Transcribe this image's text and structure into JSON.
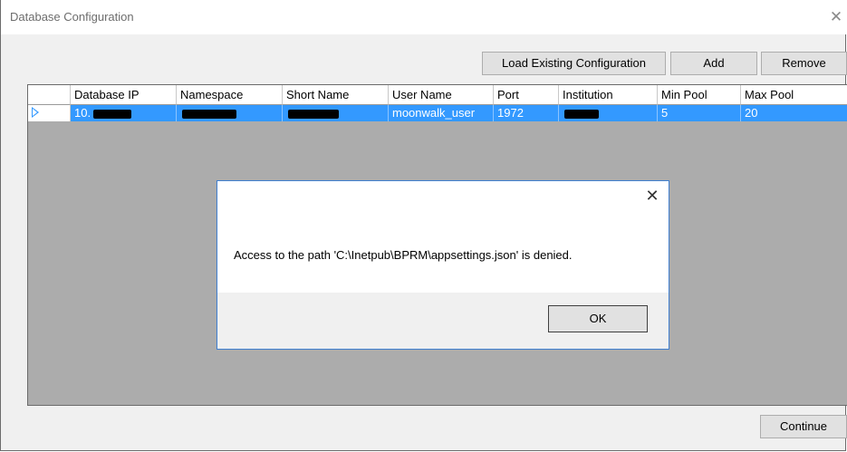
{
  "window": {
    "title": "Database Configuration",
    "close_glyph": "✕"
  },
  "toolbar": {
    "load_label": "Load Existing Configuration",
    "add_label": "Add",
    "remove_label": "Remove"
  },
  "grid": {
    "columns": [
      "Database IP",
      "Namespace",
      "Short Name",
      "User Name",
      "Port",
      "Institution",
      "Min Pool",
      "Max Pool"
    ],
    "rows": [
      {
        "database_ip": "10.",
        "namespace": "",
        "short_name": "",
        "user_name": "moonwalk_user",
        "port": "1972",
        "institution": "",
        "min_pool": "5",
        "max_pool": "20"
      }
    ]
  },
  "dialog": {
    "message": "Access to the path 'C:\\Inetpub\\BPRM\\appsettings.json' is denied.",
    "ok_label": "OK",
    "close_glyph": "✕"
  },
  "footer": {
    "continue_label": "Continue"
  },
  "colors": {
    "selection": "#3399ff",
    "grid_background": "#acacac",
    "dialog_border": "#3f7fd1"
  }
}
